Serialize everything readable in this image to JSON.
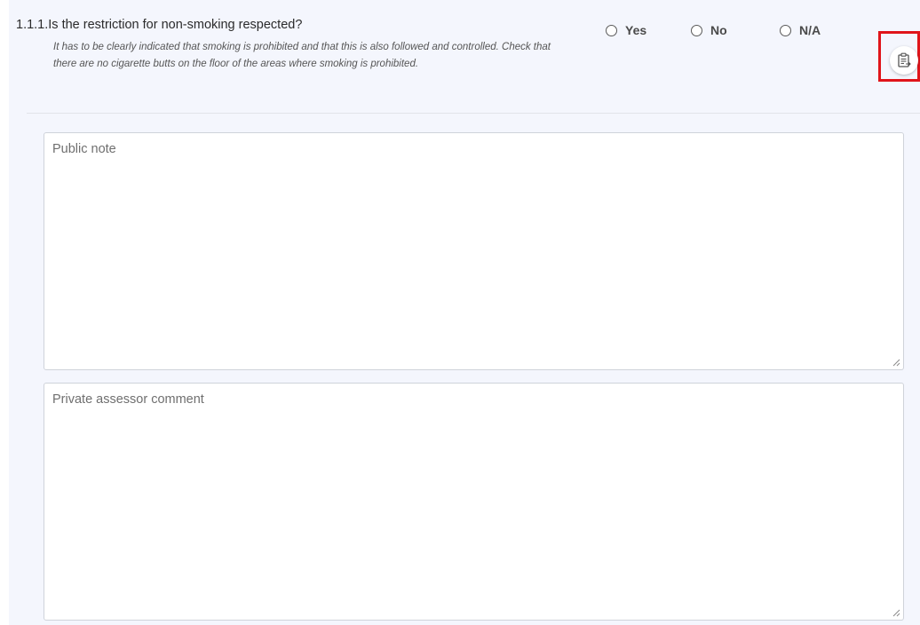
{
  "question": {
    "number": "1.1.1.",
    "title": "Is the restriction for non-smoking respected?",
    "description": "It has to be clearly indicated that smoking is prohibited and that this is also followed and controlled. Check that there are no cigarette butts on the floor of the areas where smoking is prohibited.",
    "options": [
      {
        "label": "Yes",
        "selected": false
      },
      {
        "label": "No",
        "selected": false
      },
      {
        "label": "N/A",
        "selected": false
      }
    ]
  },
  "clipboard_button": {
    "icon": "clipboard-icon",
    "highlighted": true,
    "highlight_color": "#e0141a"
  },
  "public_note": {
    "placeholder": "Public note",
    "value": ""
  },
  "private_comment": {
    "placeholder": "Private assessor comment",
    "value": ""
  },
  "colors": {
    "panel_background": "#f4f6fd",
    "text": "#2b2b2b"
  }
}
